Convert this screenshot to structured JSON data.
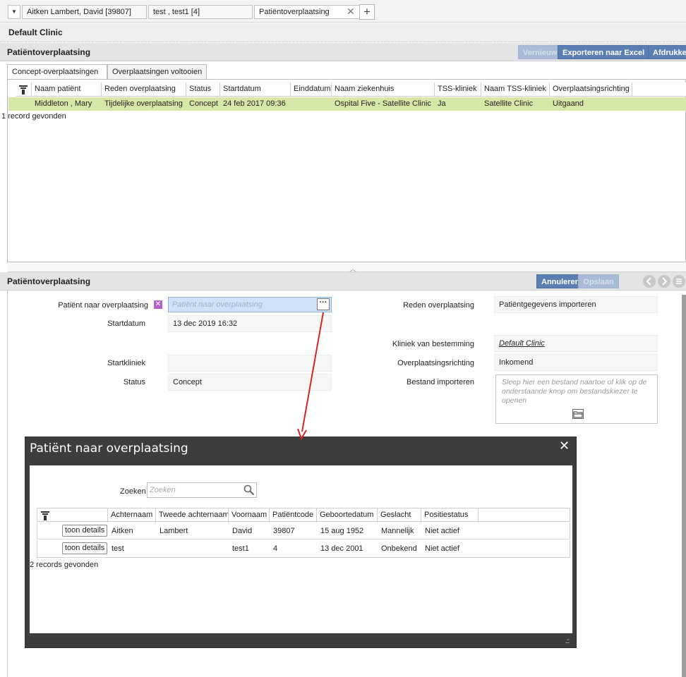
{
  "top_tabs": [
    {
      "label": "Aitken Lambert, David [39807]"
    },
    {
      "label": "test , test1 [4]"
    },
    {
      "label": "Patiëntoverplaatsing"
    }
  ],
  "clinic": "Default Clinic",
  "list_section": {
    "title": "Patiëntoverplaatsing",
    "buttons": {
      "refresh": "Vernieuwen",
      "export": "Exporteren naar Excel",
      "print": "Afdrukken"
    },
    "tabs": [
      "Concept-overplaatsingen",
      "Overplaatsingen voltooien"
    ],
    "columns": [
      "Naam patiënt",
      "Reden overplaatsing",
      "Status",
      "Startdatum",
      "Einddatum",
      "Naam ziekenhuis",
      "TSS-kliniek",
      "Naam TSS-kliniek",
      "Overplaatsingsrichting"
    ],
    "rows": [
      [
        "Middleton , Mary",
        "Tijdelijke overplaatsing",
        "Concept",
        "24 feb 2017 09:36",
        "",
        "Ospital Five - Satellite Clinic",
        "Ja",
        "Satellite Clinic",
        "Uitgaand"
      ]
    ],
    "count": "1 record gevonden",
    "row_color": "#d6e8a8"
  },
  "detail": {
    "title": "Patiëntoverplaatsing",
    "buttons": {
      "cancel": "Annuleren",
      "save": "Opslaan"
    },
    "fields": {
      "patient_label": "Patiënt naar overplaatsing",
      "patient_placeholder": "Patiënt naar overplaatsing",
      "startdatum_label": "Startdatum",
      "startdatum_value": "13 dec 2019 16:32",
      "startkliniek_label": "Startkliniek",
      "startkliniek_value": "",
      "status_label": "Status",
      "status_value": "Concept",
      "reden_label": "Reden overplaatsing",
      "reden_value": "Patiëntgegevens importeren",
      "kliniek_label": "Kliniek van bestemming",
      "kliniek_value": "Default Clinic",
      "richting_label": "Overplaatsingsrichting",
      "richting_value": "Inkomend",
      "bestand_label": "Bestand importeren",
      "bestand_hint": "Sleep hier een bestand naartoe of klik op de onderstaande knop om bestandskiezer te openen"
    }
  },
  "modal": {
    "title": "Patiënt naar overplaatsing",
    "search_label": "Zoeken",
    "search_placeholder": "Zoeken",
    "columns": [
      "Achternaam",
      "Tweede achternaam",
      "Voornaam",
      "Patiëntcode",
      "Geboortedatum",
      "Geslacht",
      "Positiestatus"
    ],
    "details_label": "toon details",
    "rows": [
      [
        "Aitken",
        "Lambert",
        "David",
        "39807",
        "15 aug 1952",
        "Mannelijk",
        "Niet actief"
      ],
      [
        "test",
        "",
        "test1",
        "4",
        "13 dec 2001",
        "Onbekend",
        "Niet actief"
      ]
    ],
    "count": "2 records gevonden"
  },
  "colors": {
    "button_blue": "#5b7fb3",
    "annotation_arrow": "#dd2222",
    "required_purple": "#b064c8"
  }
}
